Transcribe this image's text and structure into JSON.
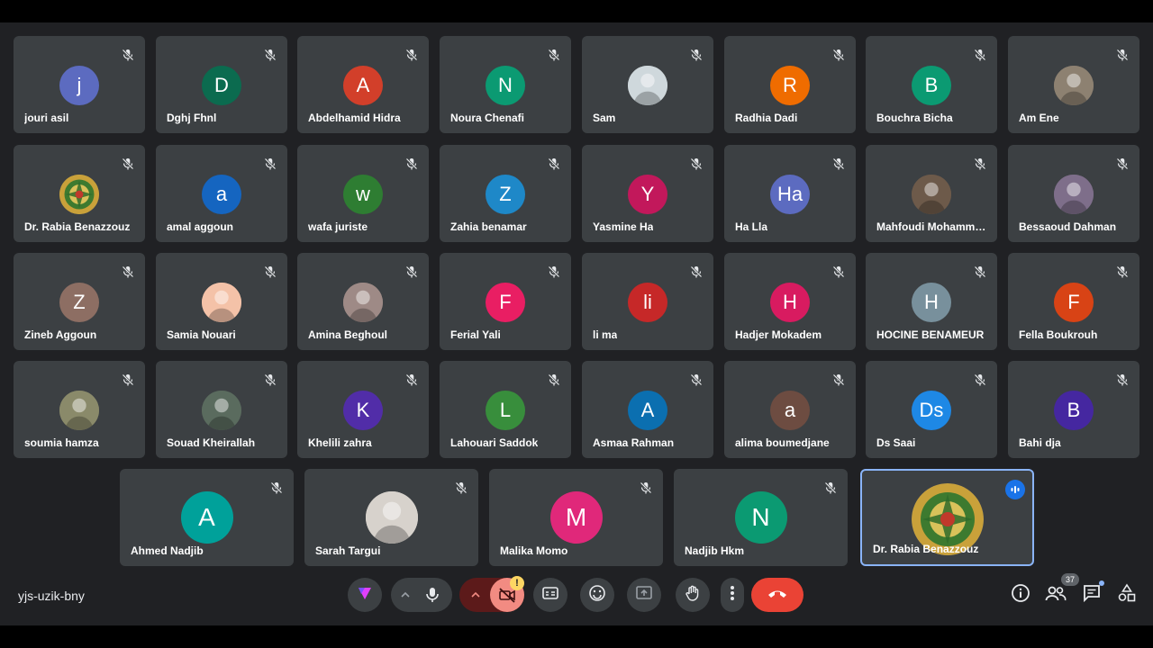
{
  "participants": [
    {
      "name": "jouri asil",
      "initial": "j",
      "color": "#5c6bc0"
    },
    {
      "name": "Dghj Fhnl",
      "initial": "D",
      "color": "#0b6b4f"
    },
    {
      "name": "Abdelhamid Hidra",
      "initial": "A",
      "color": "#d23f2a"
    },
    {
      "name": "Noura Chenafi",
      "initial": "N",
      "color": "#0b9a72"
    },
    {
      "name": "Sam",
      "initial": "",
      "color": "#cfd8dc",
      "photo": true
    },
    {
      "name": "Radhia Dadi",
      "initial": "R",
      "color": "#ef6c00"
    },
    {
      "name": "Bouchra Bicha",
      "initial": "B",
      "color": "#0b9a72"
    },
    {
      "name": "Am Ene",
      "initial": "",
      "color": "#8d8171",
      "photo": true
    },
    {
      "name": "Dr. Rabia Benazzouz",
      "initial": "",
      "color": "#d4b04a",
      "emblem": true
    },
    {
      "name": "amal aggoun",
      "initial": "a",
      "color": "#1565c0"
    },
    {
      "name": "wafa juriste",
      "initial": "w",
      "color": "#2e7d32"
    },
    {
      "name": "Zahia benamar",
      "initial": "Z",
      "color": "#1e88c8"
    },
    {
      "name": "Yasmine Ha",
      "initial": "Y",
      "color": "#c2185b"
    },
    {
      "name": "Ha Lla",
      "initial": "Ha",
      "color": "#5c6bc0"
    },
    {
      "name": "Mahfoudi Mohammed",
      "initial": "",
      "color": "#6d5a4a",
      "photo": true
    },
    {
      "name": "Bessaoud Dahman",
      "initial": "",
      "color": "#7e6e8a",
      "photo": true
    },
    {
      "name": "Zineb Aggoun",
      "initial": "Z",
      "color": "#8d6e63"
    },
    {
      "name": "Samia Nouari",
      "initial": "",
      "color": "#f4c2a8",
      "photo": true
    },
    {
      "name": "Amina Beghoul",
      "initial": "",
      "color": "#9e8a86",
      "photo": true
    },
    {
      "name": "Ferial Yali",
      "initial": "F",
      "color": "#e91e63"
    },
    {
      "name": "li ma",
      "initial": "li",
      "color": "#c62828"
    },
    {
      "name": "Hadjer Mokadem",
      "initial": "H",
      "color": "#d81b60"
    },
    {
      "name": "HOCINE BENAMEUR",
      "initial": "H",
      "color": "#78909c"
    },
    {
      "name": "Fella Boukrouh",
      "initial": "F",
      "color": "#d84315"
    },
    {
      "name": "soumia hamza",
      "initial": "",
      "color": "#8a8a6a",
      "photo": true
    },
    {
      "name": "Souad Kheirallah",
      "initial": "",
      "color": "#5a6b5e",
      "photo": true
    },
    {
      "name": "Khelili zahra",
      "initial": "K",
      "color": "#512da8"
    },
    {
      "name": "Lahouari Saddok",
      "initial": "L",
      "color": "#388e3c"
    },
    {
      "name": "Asmaa Rahman",
      "initial": "A",
      "color": "#0b6fb0"
    },
    {
      "name": "alima boumedjane",
      "initial": "a",
      "color": "#6d4c41"
    },
    {
      "name": "Ds Saai",
      "initial": "Ds",
      "color": "#1e88e5"
    },
    {
      "name": "Bahi dja",
      "initial": "B",
      "color": "#4527a0"
    },
    {
      "name": "Ahmed Nadjib",
      "initial": "A",
      "color": "#00a19a"
    },
    {
      "name": "Sarah Targui",
      "initial": "",
      "color": "#d7d2cc",
      "photo": true
    },
    {
      "name": "Malika Momo",
      "initial": "M",
      "color": "#e0287a"
    },
    {
      "name": "Nadjib Hkm",
      "initial": "N",
      "color": "#0b9a72"
    },
    {
      "name": "Dr. Rabia Benazzouz",
      "initial": "",
      "color": "#6b6b6b",
      "emblem": true,
      "speaking": true
    }
  ],
  "meeting": {
    "code": "yjs-uzik-bny",
    "participants_count": "37"
  },
  "colors": {
    "stage": "#202124",
    "tile": "#3c4043",
    "end_call": "#ea4335",
    "camera_off": "#f28b82",
    "speaking_border": "#8ab4f8",
    "warning": "#fdd663"
  }
}
